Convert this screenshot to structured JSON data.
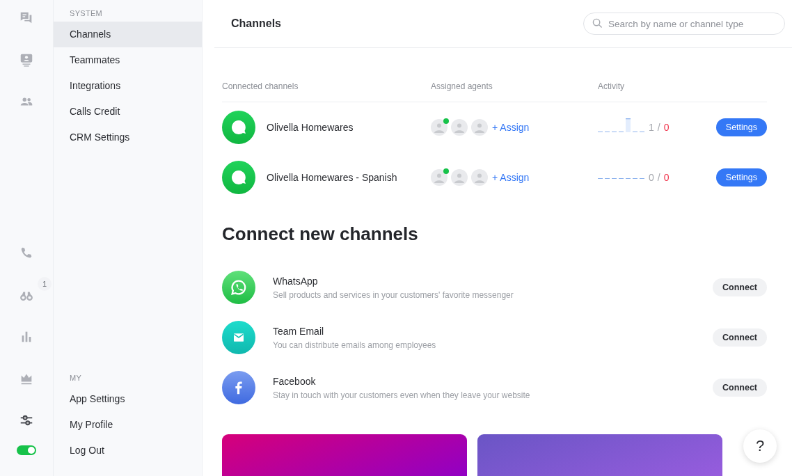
{
  "rail": {
    "top": [
      {
        "kind": "chat",
        "selected": false
      },
      {
        "kind": "contact",
        "selected": false
      },
      {
        "kind": "team",
        "selected": false
      }
    ],
    "bottom": [
      {
        "kind": "phone",
        "selected": false
      },
      {
        "kind": "binoculars",
        "selected": false,
        "badge": "1"
      },
      {
        "kind": "chart",
        "selected": false
      },
      {
        "kind": "crown",
        "selected": false
      },
      {
        "kind": "sliders",
        "selected": true
      }
    ],
    "toggle": {
      "on": true
    }
  },
  "sidebar": {
    "sections": [
      {
        "heading": "SYSTEM",
        "items": [
          {
            "label": "Channels",
            "selected": true
          },
          {
            "label": "Teammates",
            "selected": false
          },
          {
            "label": "Integrations",
            "selected": false
          },
          {
            "label": "Calls Credit",
            "selected": false
          },
          {
            "label": "CRM Settings",
            "selected": false
          }
        ]
      },
      {
        "heading": "MY",
        "items": [
          {
            "label": "App Settings",
            "selected": false
          },
          {
            "label": "My Profile",
            "selected": false
          },
          {
            "label": "Log Out",
            "selected": false
          }
        ]
      }
    ]
  },
  "header": {
    "title": "Channels",
    "search": {
      "placeholder": "Search by name or channel type"
    }
  },
  "connected": {
    "columns": [
      "Connected channels",
      "Assigned agents",
      "Activity"
    ],
    "rows": [
      {
        "name": "Olivella Homewares",
        "agents": [
          {
            "online": true
          },
          {
            "online": false
          },
          {
            "online": false
          }
        ],
        "assign": "+ Assign",
        "count": "1",
        "separator": "/",
        "missed": "0",
        "button": "Settings"
      },
      {
        "name": "Olivella Homewares - Spanish",
        "agents": [
          {
            "online": true
          },
          {
            "online": false
          },
          {
            "online": false
          }
        ],
        "assign": "+ Assign",
        "count": "0",
        "separator": "/",
        "missed": "0",
        "button": "Settings"
      }
    ]
  },
  "connect": {
    "heading": "Connect new channels",
    "items": [
      {
        "kind": "whatsapp",
        "name": "WhatsApp",
        "description": "Sell products and services in your customers' favorite messenger",
        "button": "Connect"
      },
      {
        "kind": "email",
        "name": "Team Email",
        "description": "You can distribute emails among employees",
        "button": "Connect"
      },
      {
        "kind": "facebook",
        "name": "Facebook",
        "description": "Stay in touch with your customers even when they leave your website",
        "button": "Connect"
      }
    ]
  },
  "help": {
    "label": "?"
  }
}
